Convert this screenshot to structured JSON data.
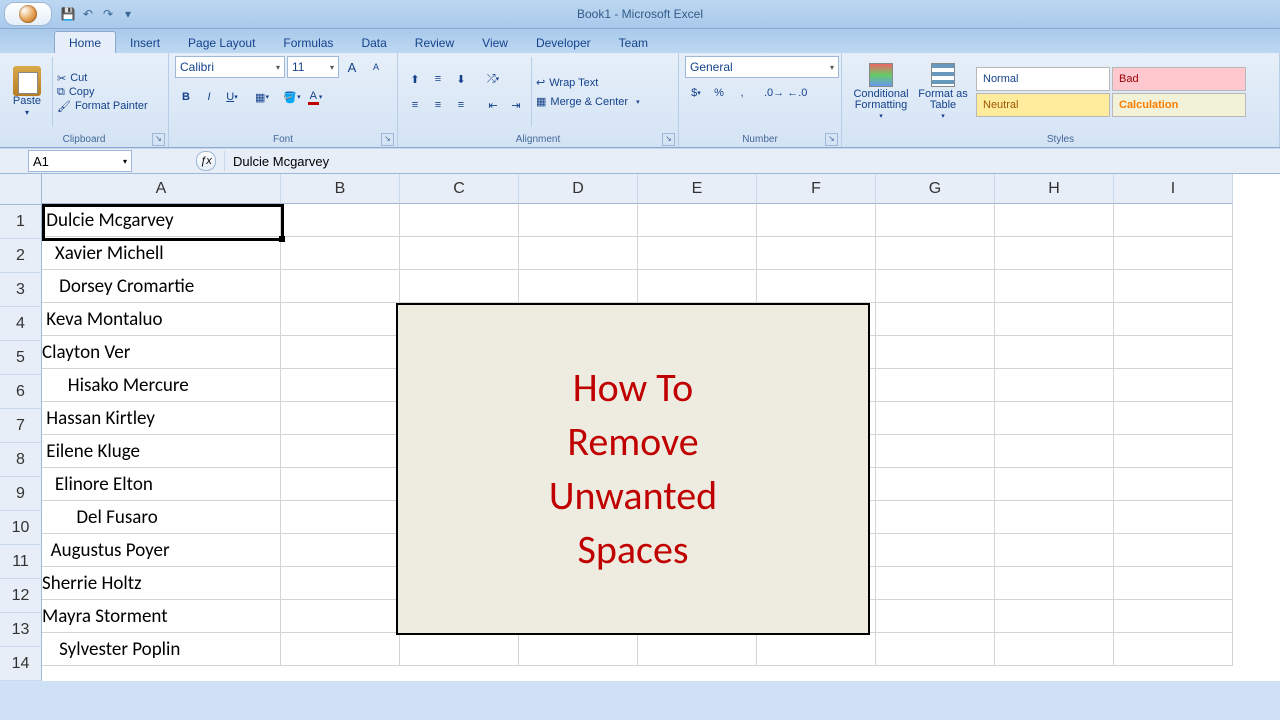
{
  "title": "Book1 - Microsoft Excel",
  "qat": {
    "save": "💾",
    "undo": "↶",
    "redo": "↷"
  },
  "tabs": [
    "Home",
    "Insert",
    "Page Layout",
    "Formulas",
    "Data",
    "Review",
    "View",
    "Developer",
    "Team"
  ],
  "active_tab": 0,
  "clipboard": {
    "paste": "Paste",
    "cut": "Cut",
    "copy": "Copy",
    "painter": "Format Painter",
    "label": "Clipboard"
  },
  "font": {
    "name": "Calibri",
    "size": "11",
    "label": "Font"
  },
  "alignment": {
    "wrap": "Wrap Text",
    "merge": "Merge & Center",
    "label": "Alignment"
  },
  "number": {
    "format": "General",
    "label": "Number"
  },
  "styles": {
    "cond": "Conditional Formatting",
    "fmt": "Format as Table",
    "label": "Styles",
    "cells": [
      {
        "t": "Normal",
        "bg": "#ffffff",
        "fg": "#000"
      },
      {
        "t": "Bad",
        "bg": "#ffc7ce",
        "fg": "#9c0006"
      },
      {
        "t": "Neutral",
        "bg": "#ffeb9c",
        "fg": "#9c5700"
      },
      {
        "t": "Calculation",
        "bg": "#fce4a0",
        "fg": "#fa7d00"
      }
    ]
  },
  "formula_bar": {
    "cell": "A1",
    "value": " Dulcie Mcgarvey"
  },
  "columns": [
    "A",
    "B",
    "C",
    "D",
    "E",
    "F",
    "G",
    "H",
    "I"
  ],
  "rows": {
    "1": " Dulcie Mcgarvey",
    "2": "   Xavier Michell",
    "3": "    Dorsey Cromartie",
    "4": " Keva Montaluo",
    "5": "Clayton Ver",
    "6": "      Hisako Mercure",
    "7": " Hassan Kirtley",
    "8": " Eilene Kluge",
    "9": "   Elinore Elton",
    "10": "        Del Fusaro",
    "11": "  Augustus Poyer",
    "12": "Sherrie Holtz",
    "13": "Mayra Storment",
    "14": "    Sylvester Poplin"
  },
  "overlay": [
    "How To",
    "Remove",
    "Unwanted",
    "Spaces"
  ]
}
